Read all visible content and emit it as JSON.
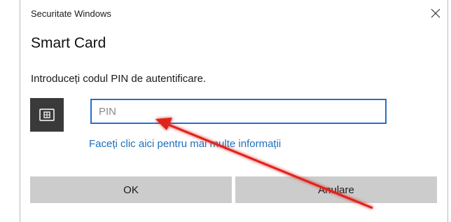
{
  "dialog": {
    "window_title": "Securitate Windows",
    "heading": "Smart Card",
    "instruction": "Introduceți codul PIN de autentificare.",
    "pin_input": {
      "value": "",
      "placeholder": "PIN"
    },
    "more_info_link": "Faceți clic aici pentru mai multe informații",
    "ok_label": "OK",
    "cancel_label": "Anulare"
  },
  "icons": {
    "close": "close-icon",
    "smart_card": "smart-card-icon"
  },
  "colors": {
    "accent": "#2a6fc4",
    "link": "#1e6fbd",
    "button": "#cccccc",
    "card_tile": "#3a3a3a",
    "annotation_arrow": "#e0231b"
  }
}
